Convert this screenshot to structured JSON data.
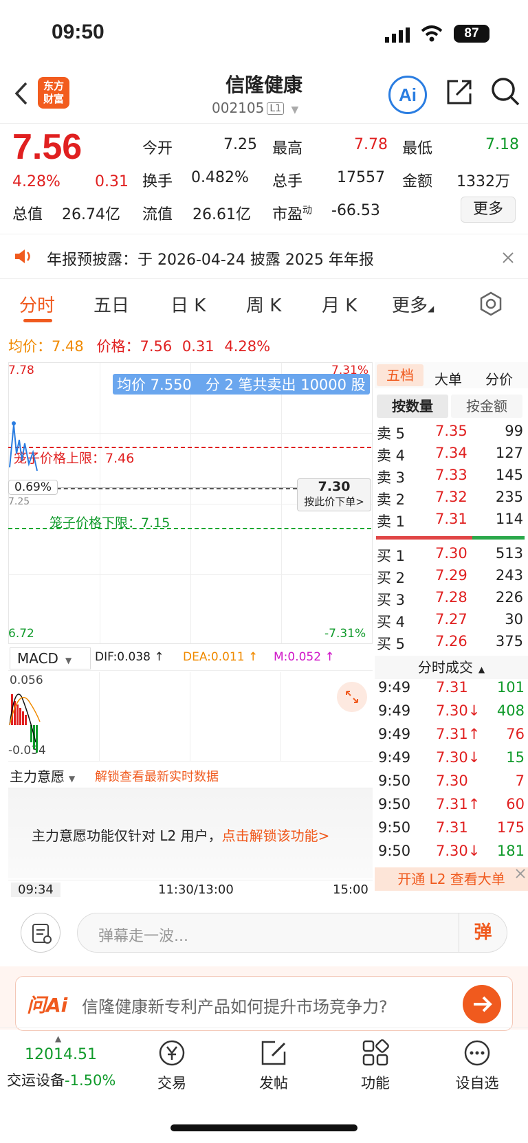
{
  "status": {
    "time": "09:50",
    "battery": "87"
  },
  "header": {
    "logo_line1": "东方",
    "logo_line2": "财富",
    "name": "信隆健康",
    "code": "002105",
    "level": "L1",
    "ai_label": "Ai"
  },
  "quote": {
    "price": "7.56",
    "change_pct": "4.28%",
    "change": "0.31",
    "open_label": "今开",
    "open": "7.25",
    "high_label": "最高",
    "high": "7.78",
    "low_label": "最低",
    "low": "7.18",
    "turnover_label": "换手",
    "turnover": "0.482%",
    "volume_label": "总手",
    "volume": "17557",
    "amount_label": "金额",
    "amount": "1332万",
    "mktcap_label": "总值",
    "mktcap": "26.74亿",
    "float_label": "流值",
    "float": "26.61亿",
    "pe_label": "市盈",
    "pe_sup": "动",
    "pe": "-66.53",
    "more": "更多"
  },
  "notice": {
    "text": "年报预披露：于 2026-04-24 披露 2025 年年报"
  },
  "tabs": [
    "分时",
    "五日",
    "日 K",
    "周 K",
    "月 K",
    "更多"
  ],
  "summary": {
    "avg_label": "均价：",
    "avg": "7.48",
    "price_label": "价格：",
    "price": "7.56",
    "change": "0.31",
    "pct": "4.28%"
  },
  "chart": {
    "top_price": "7.78",
    "top_pct": "7.31%",
    "bottom_price": "6.72",
    "bottom_pct": "-7.31%",
    "tooltip": "均价 7.550   分 2 笔共卖出 10000 股",
    "upper_limit": "笼子价格上限：7.46",
    "lower_limit": "笼子价格下限：7.15",
    "cursor_pct": "0.69%",
    "cursor_price": "7.30",
    "cursor_action": "按此价下单>",
    "open_price_label": "7.25",
    "macd_label": "MACD",
    "dif": "DIF:0.038 ↑",
    "dea": "DEA:0.011 ↑",
    "m": "M:0.052 ↑",
    "macd_top": "0.056",
    "macd_bottom": "-0.034",
    "zlyy_label": "主力意愿",
    "zlyy_unlock": "解锁查看最新实时数据",
    "zlyy_msg": "主力意愿功能仅针对 L2 用户，",
    "zlyy_link": "点击解锁该功能>",
    "time_start": "09:34",
    "time_mid": "11:30/13:00",
    "time_end": "15:00"
  },
  "orderbook": {
    "tabs": [
      "五档",
      "大单",
      "分价"
    ],
    "subtabs": [
      "按数量",
      "按金额"
    ],
    "asks": [
      {
        "label": "卖 5",
        "price": "7.35",
        "vol": "99"
      },
      {
        "label": "卖 4",
        "price": "7.34",
        "vol": "127"
      },
      {
        "label": "卖 3",
        "price": "7.33",
        "vol": "145"
      },
      {
        "label": "卖 2",
        "price": "7.32",
        "vol": "235"
      },
      {
        "label": "卖 1",
        "price": "7.31",
        "vol": "114"
      }
    ],
    "bids": [
      {
        "label": "买 1",
        "price": "7.30",
        "vol": "513"
      },
      {
        "label": "买 2",
        "price": "7.29",
        "vol": "243"
      },
      {
        "label": "买 3",
        "price": "7.28",
        "vol": "226"
      },
      {
        "label": "买 4",
        "price": "7.27",
        "vol": "30"
      },
      {
        "label": "买 5",
        "price": "7.26",
        "vol": "375"
      }
    ]
  },
  "ticks": {
    "title": "分时成交",
    "rows": [
      {
        "time": "9:49",
        "price": "7.31",
        "vol": "101",
        "color": "green"
      },
      {
        "time": "9:49",
        "price": "7.30↓",
        "vol": "408",
        "color": "green"
      },
      {
        "time": "9:49",
        "price": "7.31↑",
        "vol": "76",
        "color": "red"
      },
      {
        "time": "9:49",
        "price": "7.30↓",
        "vol": "15",
        "color": "green"
      },
      {
        "time": "9:50",
        "price": "7.30",
        "vol": "7",
        "color": "red"
      },
      {
        "time": "9:50",
        "price": "7.31↑",
        "vol": "60",
        "color": "red"
      },
      {
        "time": "9:50",
        "price": "7.31",
        "vol": "175",
        "color": "red"
      },
      {
        "time": "9:50",
        "price": "7.30↓",
        "vol": "181",
        "color": "green"
      }
    ],
    "l2_banner": "开通 L2 查看大单"
  },
  "danmaku": {
    "placeholder": "弹幕走一波...",
    "btn": "弹"
  },
  "ask_ai": {
    "brand": "问Ai",
    "question": "信隆健康新专利产品如何提升市场竞争力?"
  },
  "bottom_nav": {
    "index_value": "12014.51",
    "index_name": "交运设备",
    "index_pct": "-1.50%",
    "items": [
      "交易",
      "发帖",
      "功能",
      "设自选"
    ]
  }
}
